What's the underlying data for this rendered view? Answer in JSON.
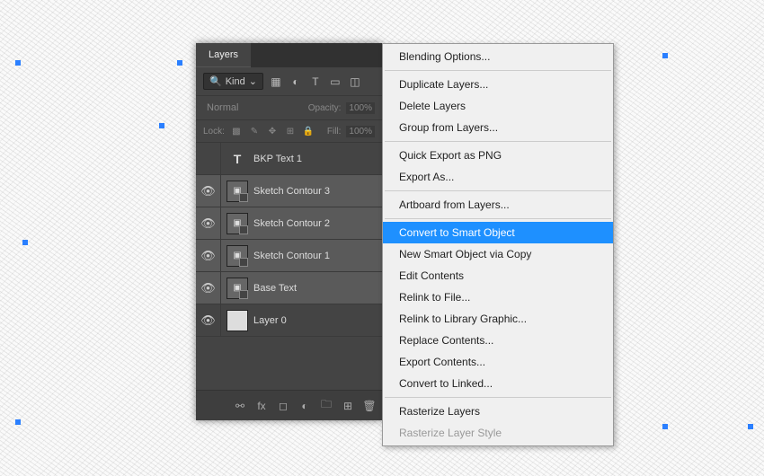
{
  "panel": {
    "tab": "Layers",
    "kind_label": "Kind",
    "blend_mode": "Normal",
    "opacity_label": "Opacity:",
    "opacity_value": "100%",
    "lock_label": "Lock:",
    "fill_label": "Fill:",
    "fill_value": "100%"
  },
  "layers": [
    {
      "name": "BKP Text 1",
      "type": "text",
      "visible": false,
      "selected": false
    },
    {
      "name": "Sketch Contour 3",
      "type": "smart",
      "visible": true,
      "selected": true
    },
    {
      "name": "Sketch Contour 2",
      "type": "smart",
      "visible": true,
      "selected": true
    },
    {
      "name": "Sketch Contour 1",
      "type": "smart",
      "visible": true,
      "selected": true
    },
    {
      "name": "Base Text",
      "type": "smart",
      "visible": true,
      "selected": true
    },
    {
      "name": "Layer 0",
      "type": "pixel",
      "visible": true,
      "selected": false
    }
  ],
  "menu": {
    "blending_options": "Blending Options...",
    "duplicate": "Duplicate Layers...",
    "delete": "Delete Layers",
    "group": "Group from Layers...",
    "quick_export": "Quick Export as PNG",
    "export_as": "Export As...",
    "artboard": "Artboard from Layers...",
    "convert_smart": "Convert to Smart Object",
    "new_smart_copy": "New Smart Object via Copy",
    "edit_contents": "Edit Contents",
    "relink_file": "Relink to File...",
    "relink_library": "Relink to Library Graphic...",
    "replace_contents": "Replace Contents...",
    "export_contents": "Export Contents...",
    "convert_linked": "Convert to Linked...",
    "rasterize_layers": "Rasterize Layers",
    "rasterize_style": "Rasterize Layer Style"
  }
}
